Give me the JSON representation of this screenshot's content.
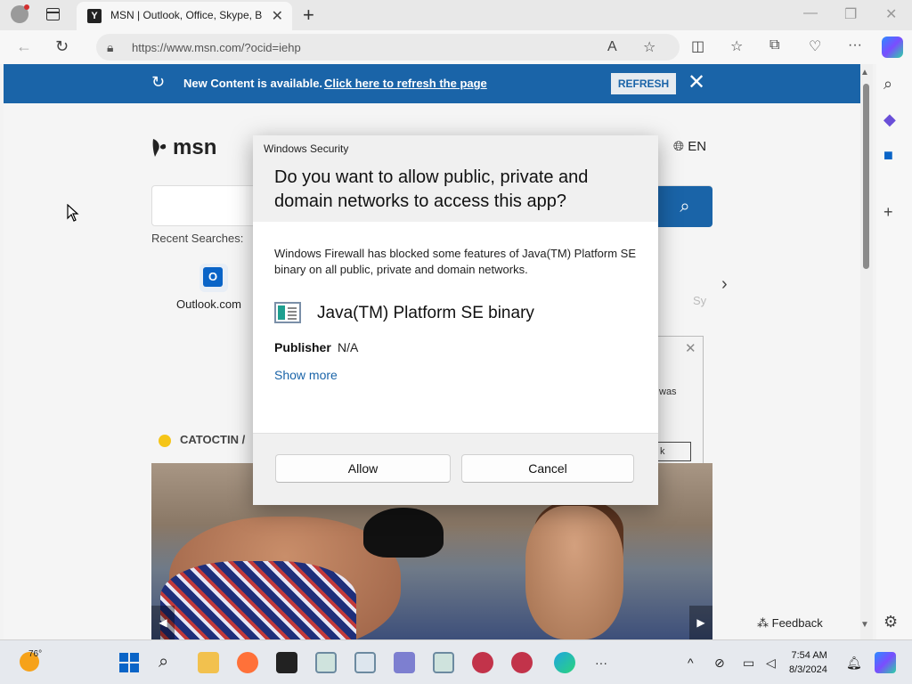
{
  "browser": {
    "tab_title": "MSN | Outlook, Office, Skype, Bi",
    "tab_favicon": "msn-favicon",
    "url": "https://www.msn.com/?ocid=iehp"
  },
  "banner": {
    "text": "New Content is available.",
    "link": "Click here to refresh the page",
    "button": "REFRESH"
  },
  "msn": {
    "logo": "msn",
    "language": "EN",
    "recent_label": "Recent Searches:",
    "recent_item": "Outlook.com",
    "recent_item_2": "Sy",
    "weather_label": "CATOCTIN /",
    "feedback": "Feedback"
  },
  "bg_dialog": {
    "fragment": "was",
    "button_fragment": "k"
  },
  "dialog": {
    "caption": "Windows Security",
    "title": "Do you want to allow public, private and domain networks to access this app?",
    "message": "Windows Firewall has blocked some features of Java(TM) Platform SE binary on all public, private and domain networks.",
    "app_name": "Java(TM) Platform SE binary",
    "publisher_label": "Publisher",
    "publisher_value": "N/A",
    "show_more": "Show more",
    "allow_button": "Allow",
    "cancel_button": "Cancel"
  },
  "taskbar": {
    "temperature": "76°",
    "time": "7:54 AM",
    "date": "8/3/2024"
  },
  "colors": {
    "banner": "#1a64a8",
    "link": "#1a64a8"
  }
}
